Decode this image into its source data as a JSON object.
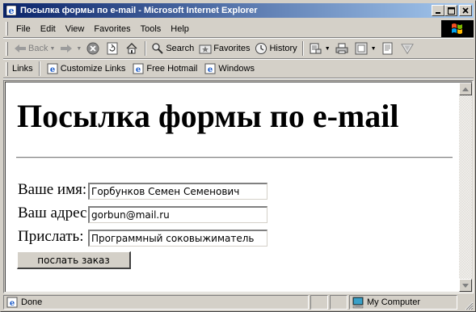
{
  "window": {
    "title": "Посылка формы по e-mail - Microsoft Internet Explorer",
    "minimize_glyph": "_",
    "maximize_glyph": "□",
    "close_glyph": "×"
  },
  "menu": {
    "items": [
      {
        "label": "File"
      },
      {
        "label": "Edit"
      },
      {
        "label": "View"
      },
      {
        "label": "Favorites"
      },
      {
        "label": "Tools"
      },
      {
        "label": "Help"
      }
    ]
  },
  "toolbar": {
    "back_label": "Back",
    "search_label": "Search",
    "favorites_label": "Favorites",
    "history_label": "History"
  },
  "links": {
    "label": "Links",
    "items": [
      {
        "label": "Customize Links"
      },
      {
        "label": "Free Hotmail"
      },
      {
        "label": "Windows"
      }
    ]
  },
  "page": {
    "heading": "Посылка формы по e-mail",
    "form": {
      "name_label": "Ваше имя:",
      "name_value": "Горбунков Семен Семенович",
      "address_label": "Ваш адрес:",
      "address_value": "gorbun@mail.ru",
      "send_label": "Прислать:",
      "send_value": "Программный соковыжиматель",
      "submit_label": "послать заказ"
    }
  },
  "status": {
    "text": "Done",
    "zone": "My Computer"
  },
  "colors": {
    "titlebar_start": "#0a246a",
    "titlebar_end": "#a6caf0",
    "chrome": "#d4d0c8"
  }
}
